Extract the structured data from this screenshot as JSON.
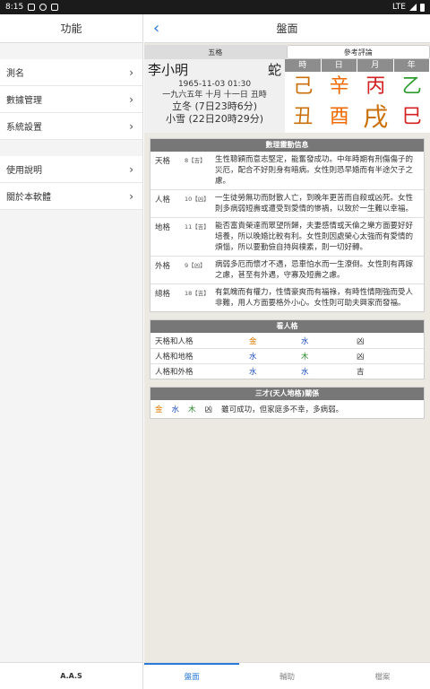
{
  "status": {
    "time": "8:15",
    "network": "LTE"
  },
  "drawer": {
    "title": "功能",
    "items_group1": [
      {
        "label": "測名"
      },
      {
        "label": "數據管理"
      },
      {
        "label": "系統設置"
      }
    ],
    "items_group2": [
      {
        "label": "使用說明"
      },
      {
        "label": "關於本軟體"
      }
    ],
    "footer": "A.A.S"
  },
  "navbar": {
    "title": "盤面"
  },
  "segments": {
    "left": "五格",
    "right": "參考評論"
  },
  "person": {
    "name": "李小明",
    "zodiac": "蛇",
    "datetime": "1965-11-03 01:30",
    "lunar": "一九六五年 十月 十一日 丑時",
    "term1": "立冬 (7日23時6分)",
    "term2": "小雪 (22日20時29分)"
  },
  "pillars": {
    "headers": [
      "時",
      "日",
      "月",
      "年"
    ],
    "stems": [
      {
        "char": "己",
        "color": "#c9700a"
      },
      {
        "char": "辛",
        "color": "#ef6a00"
      },
      {
        "char": "丙",
        "color": "#d42121"
      },
      {
        "char": "乙",
        "color": "#2e9b2e"
      }
    ],
    "branches": [
      {
        "char": "丑",
        "color": "#c9700a"
      },
      {
        "char": "酉",
        "color": "#ef6a00"
      },
      {
        "char": "戌",
        "color": "#c9700a"
      },
      {
        "char": "巳",
        "color": "#d42121"
      }
    ]
  },
  "numerology": {
    "title": "數理靈動信息",
    "rows": [
      {
        "label": "天格",
        "score": "8【吉】",
        "desc": "生性聰穎而意志堅定，能奮發成功。中年時期有刑傷傷子的災厄，配合不好則身有暗病。女性則恐早婚而有半途欠子之慮。"
      },
      {
        "label": "人格",
        "score": "10【凶】",
        "desc": "一生徒勞無功而財散人亡，到晚年更苦而自殺或凶死。女性則多病弱短壽或遭受到愛情的慘禍，以致於一生難以幸福。"
      },
      {
        "label": "地格",
        "score": "11【吉】",
        "desc": "能否富貴榮達而眾望所歸，夫妻感情或天倫之樂方面要好好培養，所以晚婚比較有利。女性則因處榮心太強而有愛情的煩惱，所以要勤儉自持與樸素，則一切好轉。"
      },
      {
        "label": "外格",
        "score": "9【凶】",
        "desc": "病弱多厄而懷才不遇，忌車怕水而一生潦倒。女性則有再嫁之慮，甚至有外遇，守寡及短壽之慮。"
      },
      {
        "label": "總格",
        "score": "18【吉】",
        "desc": "有氣魄而有權力，性情豪爽而有福祿，有時性情剛強而受人非難，用人方面要格外小心。女性則可助夫興家而發福。"
      }
    ]
  },
  "personality": {
    "title": "看人格",
    "rows": [
      {
        "name": "天格和人格",
        "a": "金",
        "a_color": "#e07a00",
        "b": "水",
        "b_color": "#2050c0",
        "result": "凶"
      },
      {
        "name": "人格和地格",
        "a": "水",
        "a_color": "#2050c0",
        "b": "木",
        "b_color": "#2e8b2e",
        "result": "凶"
      },
      {
        "name": "人格和外格",
        "a": "水",
        "a_color": "#2050c0",
        "b": "水",
        "b_color": "#2050c0",
        "result": "吉"
      }
    ]
  },
  "sancai": {
    "title": "三才(天人地格)關係",
    "elements": [
      {
        "char": "金",
        "color": "#e07a00"
      },
      {
        "char": "水",
        "color": "#2050c0"
      },
      {
        "char": "木",
        "color": "#2e8b2e"
      }
    ],
    "result": "凶",
    "desc": "雖可成功，但家庭多不幸，多病弱。"
  },
  "tabs": [
    {
      "label": "盤面"
    },
    {
      "label": "輔助"
    },
    {
      "label": "檔案"
    }
  ]
}
